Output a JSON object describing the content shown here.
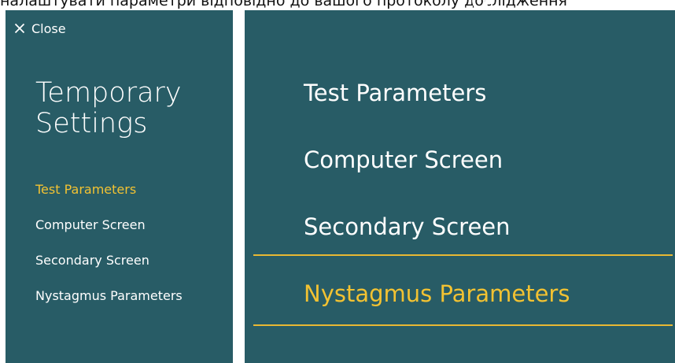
{
  "caption": {
    "text": "налаштувати параметри відповідно до вашого протоколу дослідження",
    "fragment": "g"
  },
  "left_panel": {
    "close_label": "Close",
    "title_line1": "Temporary",
    "title_line2": "Settings",
    "nav": [
      {
        "label": "Test Parameters",
        "active": true
      },
      {
        "label": "Computer Screen",
        "active": false
      },
      {
        "label": "Secondary Screen",
        "active": false
      },
      {
        "label": "Nystagmus Parameters",
        "active": false
      }
    ]
  },
  "right_panel": {
    "items": [
      {
        "label": "Test Parameters",
        "active": false
      },
      {
        "label": "Computer Screen",
        "active": false
      },
      {
        "label": "Secondary Screen",
        "active": false
      },
      {
        "label": "Nystagmus Parameters",
        "active": true
      }
    ]
  },
  "colors": {
    "panel_bg": "#285c66",
    "accent_yellow": "#f2c232",
    "text_white": "#ffffff"
  },
  "icons": {
    "close": "close-icon"
  }
}
